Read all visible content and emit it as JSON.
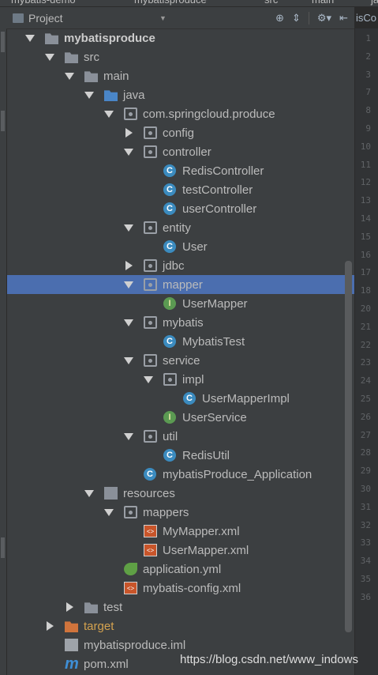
{
  "top_breadcrumb": [
    "mybatis-demo",
    "mybatisproduce",
    "src",
    "main",
    "ja"
  ],
  "header": {
    "title": "Project",
    "tools": [
      "crosshair-icon",
      "collapse-icon",
      "gear-icon",
      "hide-icon"
    ]
  },
  "editor_tab_text": "isCo",
  "tree": [
    {
      "label": "mybatisproduce",
      "depth": 1,
      "arrow": "down",
      "icon": "module-folder",
      "bold": true
    },
    {
      "label": "src",
      "depth": 2,
      "arrow": "down",
      "icon": "folder"
    },
    {
      "label": "main",
      "depth": 3,
      "arrow": "down",
      "icon": "folder"
    },
    {
      "label": "java",
      "depth": 4,
      "arrow": "down",
      "icon": "source-folder"
    },
    {
      "label": "com.springcloud.produce",
      "depth": 5,
      "arrow": "down",
      "icon": "package"
    },
    {
      "label": "config",
      "depth": 6,
      "arrow": "right",
      "icon": "package"
    },
    {
      "label": "controller",
      "depth": 6,
      "arrow": "down",
      "icon": "package"
    },
    {
      "label": "RedisController",
      "depth": 7,
      "arrow": "none",
      "icon": "class"
    },
    {
      "label": "testController",
      "depth": 7,
      "arrow": "none",
      "icon": "class"
    },
    {
      "label": "userController",
      "depth": 7,
      "arrow": "none",
      "icon": "class"
    },
    {
      "label": "entity",
      "depth": 6,
      "arrow": "down",
      "icon": "package"
    },
    {
      "label": "User",
      "depth": 7,
      "arrow": "none",
      "icon": "class"
    },
    {
      "label": "jdbc",
      "depth": 6,
      "arrow": "right",
      "icon": "package"
    },
    {
      "label": "mapper",
      "depth": 6,
      "arrow": "down",
      "icon": "package",
      "selected": true
    },
    {
      "label": "UserMapper",
      "depth": 7,
      "arrow": "none",
      "icon": "interface"
    },
    {
      "label": "mybatis",
      "depth": 6,
      "arrow": "down",
      "icon": "package"
    },
    {
      "label": "MybatisTest",
      "depth": 7,
      "arrow": "none",
      "icon": "class"
    },
    {
      "label": "service",
      "depth": 6,
      "arrow": "down",
      "icon": "package"
    },
    {
      "label": "impl",
      "depth": 7,
      "arrow": "down",
      "icon": "package"
    },
    {
      "label": "UserMapperImpl",
      "depth": 8,
      "arrow": "none",
      "icon": "class"
    },
    {
      "label": "UserService",
      "depth": 7,
      "arrow": "none",
      "icon": "interface"
    },
    {
      "label": "util",
      "depth": 6,
      "arrow": "down",
      "icon": "package"
    },
    {
      "label": "RedisUtil",
      "depth": 7,
      "arrow": "none",
      "icon": "class"
    },
    {
      "label": "mybatisProduce_Application",
      "depth": 6,
      "arrow": "none",
      "icon": "spring-class"
    },
    {
      "label": "resources",
      "depth": 4,
      "arrow": "down",
      "icon": "resources-folder"
    },
    {
      "label": "mappers",
      "depth": 5,
      "arrow": "down",
      "icon": "package"
    },
    {
      "label": "MyMapper.xml",
      "depth": 6,
      "arrow": "none",
      "icon": "xml"
    },
    {
      "label": "UserMapper.xml",
      "depth": 6,
      "arrow": "none",
      "icon": "xml"
    },
    {
      "label": "application.yml",
      "depth": 5,
      "arrow": "none",
      "icon": "yml"
    },
    {
      "label": "mybatis-config.xml",
      "depth": 5,
      "arrow": "none",
      "icon": "xml"
    },
    {
      "label": "test",
      "depth": 3,
      "arrow": "right",
      "icon": "folder"
    },
    {
      "label": "target",
      "depth": 2,
      "arrow": "right",
      "icon": "excluded-folder",
      "orange": true
    },
    {
      "label": "mybatisproduce.iml",
      "depth": 2,
      "arrow": "none",
      "icon": "iml-file"
    },
    {
      "label": "pom.xml",
      "depth": 2,
      "arrow": "none",
      "icon": "maven-pom"
    }
  ],
  "line_numbers": [
    "1",
    "2",
    "3",
    "7",
    "8",
    "9",
    "10",
    "11",
    "12",
    "13",
    "14",
    "15",
    "16",
    "17",
    "18",
    "20",
    "21",
    "22",
    "23",
    "24",
    "25",
    "26",
    "27",
    "28",
    "29",
    "30",
    "31",
    "32",
    "33",
    "34",
    "35",
    "36"
  ],
  "watermark": "https://blog.csdn.net/www_indows"
}
